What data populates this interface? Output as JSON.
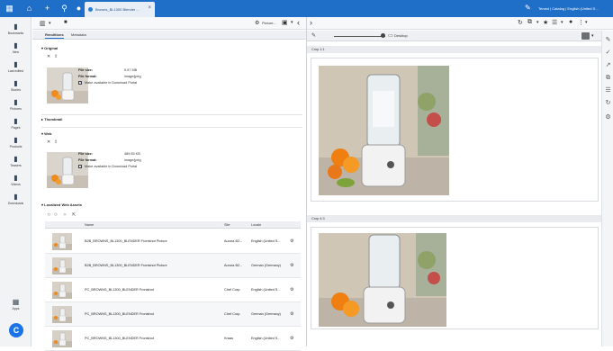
{
  "topbar": {
    "active_tab": "Browns_BL1300 Blender ...",
    "close": "×",
    "user": "Tenant | Catalog | English (United S..."
  },
  "sidebar": {
    "items": [
      {
        "label": "Bookmarks",
        "icon": "bookmark-icon"
      },
      {
        "label": "New",
        "icon": "new-icon"
      },
      {
        "label": "Last edited",
        "icon": "last-edited-icon"
      },
      {
        "label": "Stories",
        "icon": "stories-icon"
      },
      {
        "label": "Pictures",
        "icon": "pictures-icon"
      },
      {
        "label": "Pages",
        "icon": "pages-icon"
      },
      {
        "label": "Products",
        "icon": "products-icon"
      },
      {
        "label": "Teasers",
        "icon": "teasers-icon"
      },
      {
        "label": "Videos",
        "icon": "videos-icon"
      },
      {
        "label": "Downloads",
        "icon": "downloads-icon"
      }
    ],
    "apps_label": "Apps",
    "logo": "C"
  },
  "toolbar2": {
    "picture_label": "Picture..."
  },
  "tabs": [
    "Renditions",
    "Metadata"
  ],
  "original": {
    "title": "Original",
    "file_size_label": "File size:",
    "file_size": "5.57 MB",
    "file_format_label": "File format:",
    "file_format": "image/jpeg",
    "download_label": "Make available in Download Portal"
  },
  "thumbnail": {
    "title": "Thumbnail"
  },
  "web": {
    "title": "Web",
    "file_size_label": "File size:",
    "file_size": "489.55 KB",
    "file_format_label": "File format:",
    "file_format": "image/jpeg",
    "download_label": "Make available in Download Portal"
  },
  "localized": {
    "title": "Localized Web Assets",
    "columns": [
      "Name",
      "Site",
      "Locale"
    ],
    "rows": [
      {
        "name": "B2B_BROWNS_BL1300_BLENDER Frontshot Picture",
        "site": "Aurora B2...",
        "locale": "English (United S..."
      },
      {
        "name": "B2B_BROWNS_BL1300_BLENDER Frontshot Picture",
        "site": "Aurora B2...",
        "locale": "German (Germany)"
      },
      {
        "name": "PC_BROWNS_BL1300_BLENDER Frontshot",
        "site": "Chef Corp.",
        "locale": "English (United S..."
      },
      {
        "name": "PC_BROWNS_BL1300_BLENDER Frontshot",
        "site": "Chef Corp.",
        "locale": "German (Germany)"
      },
      {
        "name": "PC_BROWNS_BL1300_BLENDER Frontshot",
        "site": "Kraas",
        "locale": "English (United S..."
      }
    ]
  },
  "preview": {
    "device_label": "Desktop",
    "crop1": "Crop 1:1",
    "crop2": "Crop 4:3"
  },
  "colors": {
    "brand_blue": "#1f6fc9",
    "logo_blue": "#1a73e8"
  }
}
